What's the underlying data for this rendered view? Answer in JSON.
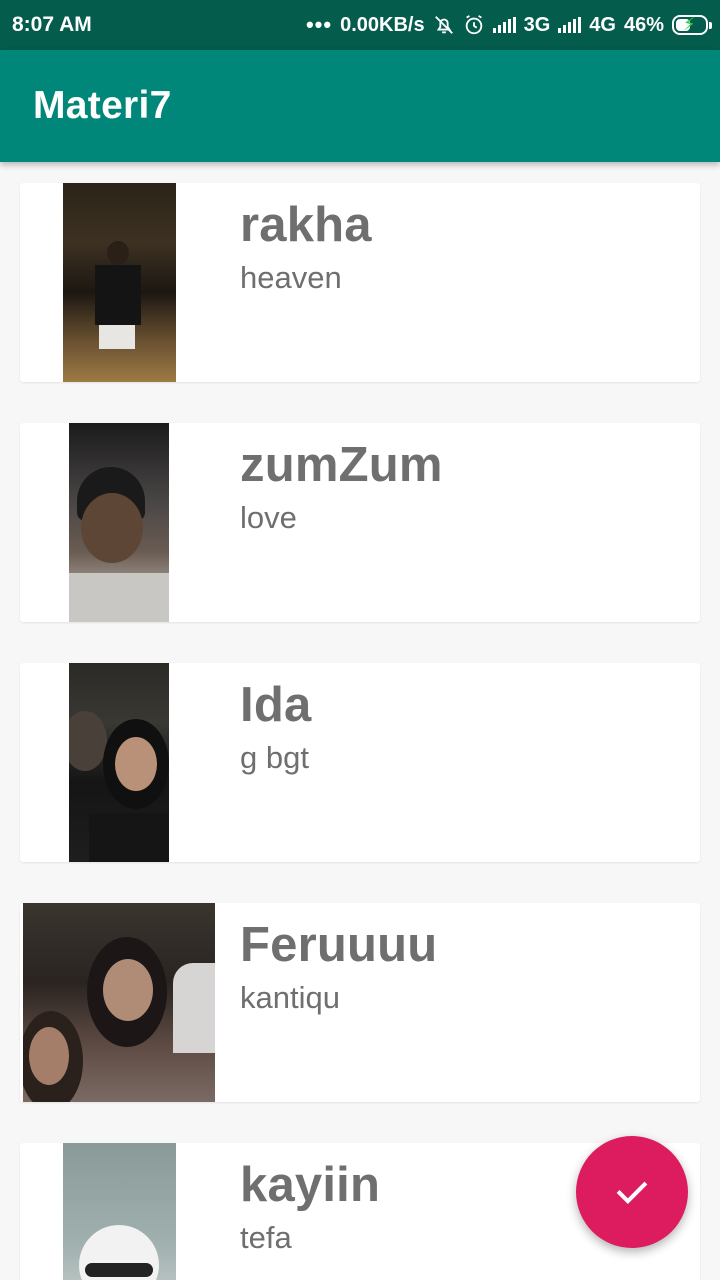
{
  "status_bar": {
    "time": "8:07 AM",
    "dots": "•••",
    "network_speed": "0.00KB/s",
    "net1": "3G",
    "net2": "4G",
    "battery": "46%"
  },
  "app_bar": {
    "title": "Materi7"
  },
  "items": [
    {
      "name": "rakha",
      "desc": "heaven"
    },
    {
      "name": "zumZum",
      "desc": "love"
    },
    {
      "name": "Ida",
      "desc": "g bgt"
    },
    {
      "name": "Feruuuu",
      "desc": "kantiqu"
    },
    {
      "name": "kayiin",
      "desc": "tefa"
    }
  ],
  "fab": {
    "icon": "check-icon"
  },
  "colors": {
    "status_bar": "#045c4d",
    "app_bar": "#00877a",
    "fab": "#dd1b5f",
    "text": "#6f6f6f"
  }
}
